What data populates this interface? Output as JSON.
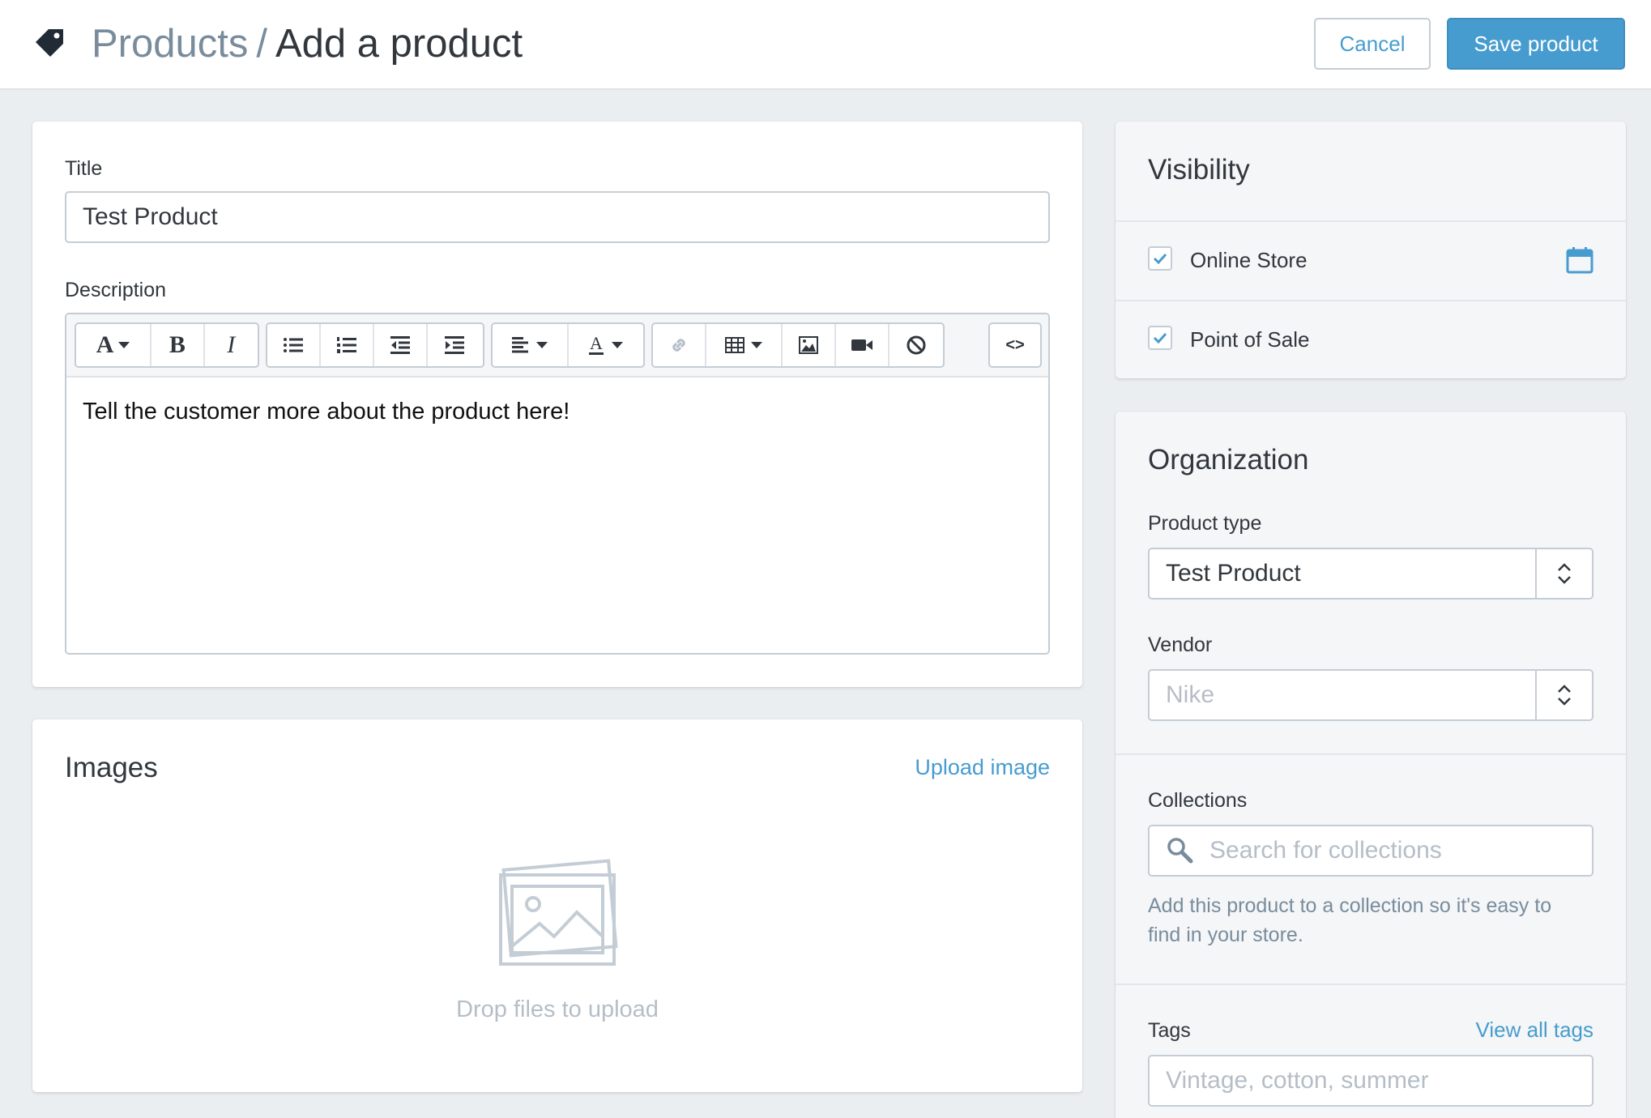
{
  "header": {
    "breadcrumb_parent": "Products",
    "breadcrumb_separator": "/",
    "page_title": "Add a product",
    "cancel_label": "Cancel",
    "save_label": "Save product",
    "icon": "tag-icon"
  },
  "product": {
    "title_label": "Title",
    "title_value": "Test Product",
    "description_label": "Description",
    "description_value": "Tell the customer more about the product here!",
    "toolbar": {
      "font_glyph": "A",
      "bold_glyph": "B",
      "italic_glyph": "I",
      "color_glyph": "A",
      "html_glyph": "<>",
      "icons": [
        "font-dropdown-icon",
        "bold-icon",
        "italic-icon",
        "bulleted-list-icon",
        "numbered-list-icon",
        "outdent-icon",
        "indent-icon",
        "align-dropdown-icon",
        "text-color-dropdown-icon",
        "link-icon",
        "table-dropdown-icon",
        "image-icon",
        "video-icon",
        "clear-formatting-icon",
        "html-source-icon"
      ]
    }
  },
  "images": {
    "title": "Images",
    "upload_link": "Upload image",
    "drop_text": "Drop files to upload"
  },
  "visibility": {
    "title": "Visibility",
    "channels": [
      {
        "label": "Online Store",
        "checked": true
      },
      {
        "label": "Point of Sale",
        "checked": true
      }
    ]
  },
  "organization": {
    "title": "Organization",
    "product_type_label": "Product type",
    "product_type_value": "Test Product",
    "vendor_label": "Vendor",
    "vendor_placeholder": "Nike",
    "collections_label": "Collections",
    "collections_placeholder": "Search for collections",
    "collections_help": "Add this product to a collection so it's easy to find in your store.",
    "tags_label": "Tags",
    "view_all_tags": "View all tags",
    "tags_placeholder": "Vintage, cotton, summer"
  },
  "colors": {
    "accent": "#479ccf",
    "page_bg": "#ebeef0",
    "text": "#31373d",
    "muted": "#798c9c",
    "placeholder": "#b5bec7",
    "border": "#c4cdd5"
  }
}
